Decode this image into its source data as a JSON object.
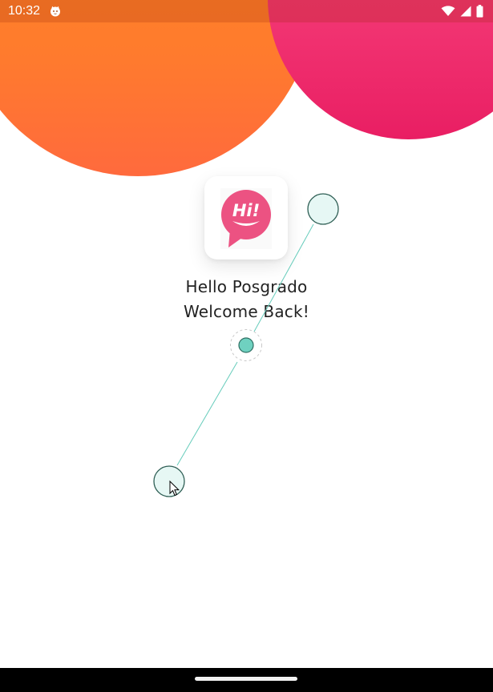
{
  "status_bar": {
    "time": "10:32",
    "app_icon": "cat-face-icon",
    "icons": [
      "wifi-icon",
      "cellular-signal-icon",
      "battery-icon"
    ]
  },
  "logo": {
    "icon": "hi-speech-bubble-icon",
    "text": "Hi!",
    "color": "#ec5282"
  },
  "greeting": {
    "line1": "Hello Posgrado",
    "line2": "Welcome Back!"
  },
  "decor": {
    "orange": "#ff7b2d",
    "pink": "#ef2f6e"
  },
  "gesture_overlay": {
    "line_color": "#66ccbb",
    "handle_fill": "#e6f7f4",
    "center_fill": "#6fd1c0",
    "icons": [
      "pinch-handle-top",
      "pinch-center",
      "pinch-handle-bottom",
      "mouse-cursor-icon"
    ]
  },
  "nav_bar": {
    "icon": "home-gesture-handle"
  }
}
